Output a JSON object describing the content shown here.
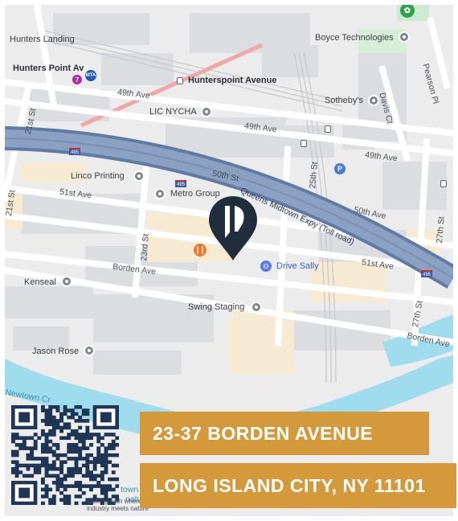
{
  "colors": {
    "banner": "#d4993a",
    "expressway": "#6f86a9",
    "water": "#9fdcee",
    "pin": "#1f2d3d",
    "qr": "#1f3555"
  },
  "map": {
    "labels": {
      "hunters_landing": "Hunters Landing",
      "hunters_point_av": "Hunters Point Av",
      "boyce": "Boyce Technologies",
      "pearson": "Pearson Pl",
      "davis": "Davis Ct",
      "hunterspoint_avenue": "Hunterspoint Avenue",
      "ave49_west": "49th Ave",
      "ave49_mid": "49th Ave",
      "ave49_east": "49th Ave",
      "lic_nycha": "LIC NYCHA",
      "sothebys": "Sotheby's",
      "st21": "21st St",
      "linco": "Linco Printing",
      "st50": "50th St",
      "ave51": "51st Ave",
      "metro_group": "Metro Group",
      "qmex": "Queens Midtown Expy (Toll road)",
      "st25": "25th St",
      "ave50": "50th Ave",
      "st27": "27th St",
      "st23": "23rd St",
      "st21b": "21st St",
      "drive_sally": "Drive Sally",
      "ave51_east": "51st Ave",
      "borden_west": "Borden Ave",
      "kenseal": "Kenseal",
      "swing_staging": "Swing Staging",
      "st27b": "27th St",
      "borden_east": "Borden Ave",
      "jason_rose": "Jason Rose",
      "creek": "Newtown Cr",
      "town": "town",
      "natur": "natur",
      "shield_495": "495"
    },
    "transit_badges": {
      "line7": "7"
    }
  },
  "address": {
    "line1": "23-37 BORDEN AVENUE",
    "line2": "LONG ISLAND CITY, NY 11101"
  },
  "qr": {
    "caption_line1": "walking path where",
    "caption_line2": "industry meets nature"
  }
}
